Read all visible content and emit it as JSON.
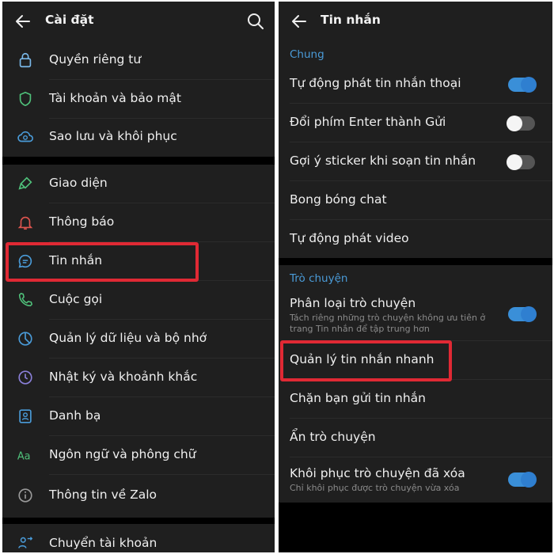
{
  "left": {
    "title": "Cài đặt",
    "items": [
      {
        "label": "Quyền riêng tư",
        "icon": "lock-icon"
      },
      {
        "label": "Tài khoản và bảo mật",
        "icon": "shield-icon"
      },
      {
        "label": "Sao lưu và khôi phục",
        "icon": "cloud-sync-icon"
      },
      {
        "label": "Giao diện",
        "icon": "paint-brush-icon"
      },
      {
        "label": "Thông báo",
        "icon": "bell-icon"
      },
      {
        "label": "Tin nhắn",
        "icon": "chat-bubble-icon"
      },
      {
        "label": "Cuộc gọi",
        "icon": "phone-icon"
      },
      {
        "label": "Quản lý dữ liệu và bộ nhớ",
        "icon": "pie-chart-icon"
      },
      {
        "label": "Nhật ký và khoảnh khắc",
        "icon": "clock-icon"
      },
      {
        "label": "Danh bạ",
        "icon": "contact-card-icon"
      },
      {
        "label": "Ngôn ngữ và phông chữ",
        "icon": "font-aa-icon"
      },
      {
        "label": "Thông tin về Zalo",
        "icon": "info-icon"
      },
      {
        "label": "Chuyển tài khoản",
        "icon": "switch-account-icon"
      }
    ]
  },
  "right": {
    "title": "Tin nhắn",
    "section_general": "Chung",
    "general": [
      {
        "label": "Tự động phát tin nhắn thoại",
        "toggle": "on"
      },
      {
        "label": "Đổi phím Enter thành Gửi",
        "toggle": "off"
      },
      {
        "label": "Gợi ý sticker khi soạn tin nhắn",
        "toggle": "off"
      },
      {
        "label": "Bong bóng chat"
      },
      {
        "label": "Tự động phát video"
      }
    ],
    "section_chat": "Trò chuyện",
    "chat": [
      {
        "label": "Phân loại trò chuyện",
        "sub": "Tách riêng những trò chuyện không ưu tiên ở trang Tin nhắn để tập trung hơn",
        "toggle": "on"
      },
      {
        "label": "Quản lý tin nhắn nhanh"
      },
      {
        "label": "Chặn bạn gửi tin nhắn"
      },
      {
        "label": "Ẩn trò chuyện"
      },
      {
        "label": "Khôi phục trò chuyện đã xóa",
        "sub": "Chỉ khôi phục được trò chuyện vừa xóa",
        "toggle": "on"
      }
    ]
  },
  "colors": {
    "accent": "#3a8fd8",
    "highlight": "#e02934",
    "background": "#000000",
    "surface": "#1f1f1f"
  }
}
